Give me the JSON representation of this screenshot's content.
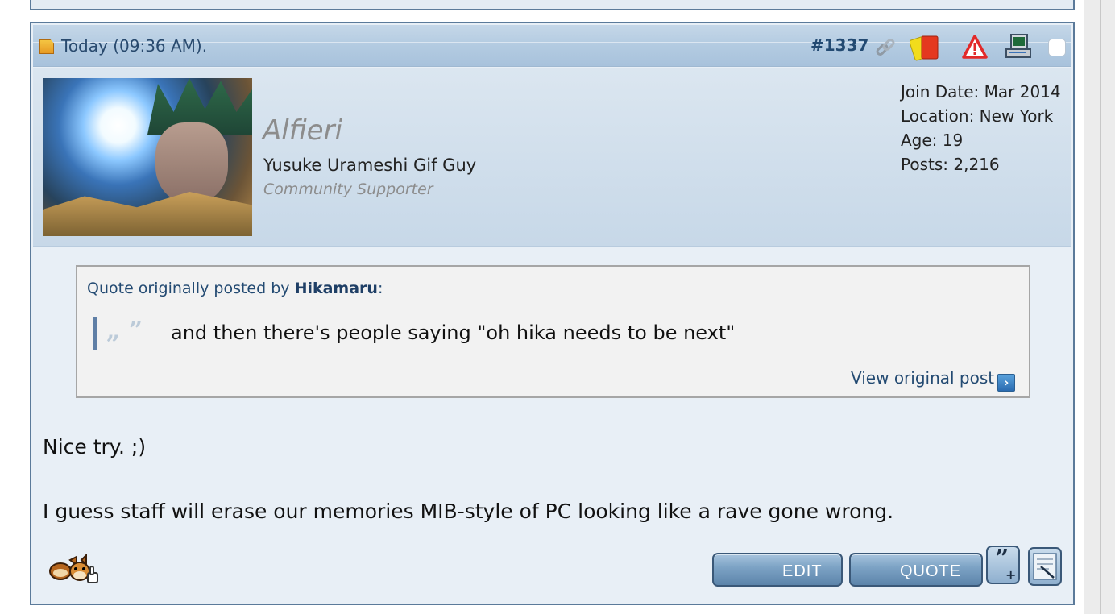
{
  "post": {
    "date": "Today (09:36 AM).",
    "number_prefix": "#",
    "number": "1337"
  },
  "user": {
    "name": "Alfieri",
    "title": "Yusuke Urameshi Gif Guy",
    "rank": "Community Supporter",
    "stats": [
      "Join Date: Mar 2014",
      "Location: New York",
      "Age: 19",
      "Posts: 2,216"
    ]
  },
  "quote": {
    "by_prefix": "Quote originally posted by ",
    "author": "Hikamaru",
    "by_suffix": ":",
    "text": "and then there's people saying \"oh hika needs to be next\"",
    "view_original": "View original post"
  },
  "message": {
    "line1": "Nice try. ;)",
    "line2": "I guess staff will erase our memories MIB-style of PC looking like a rave gone wrong."
  },
  "buttons": {
    "edit": "EDIT",
    "quote": "QUOTE"
  },
  "icons": {
    "date": "post-date-icon",
    "permalink": "link-icon",
    "infraction": "yellow-red-card-icon",
    "report": "warning-icon",
    "ip": "computer-icon",
    "multiquote": "multiquote-icon",
    "quick_reply": "quick-reply-icon",
    "mascot": "fox-thumbs-up-icon"
  },
  "colors": {
    "border": "#5b7a9a",
    "header_blue": "#b3cbe1",
    "link": "#234a72"
  }
}
